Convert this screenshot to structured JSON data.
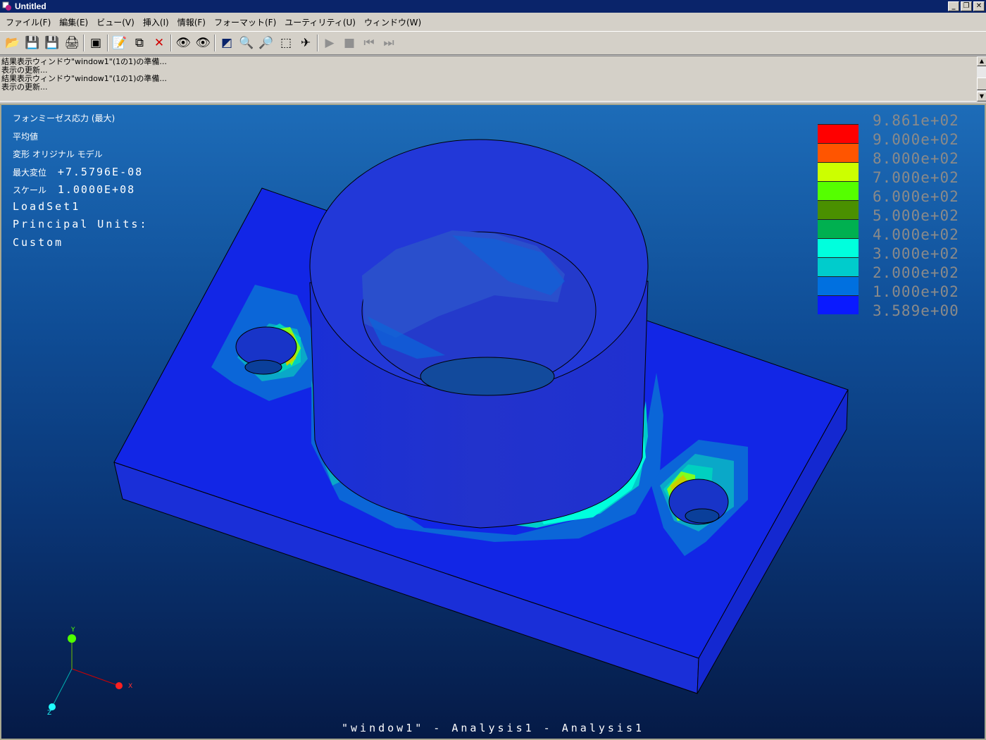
{
  "window": {
    "title": "Untitled",
    "minimize": "_",
    "restore": "❐",
    "close": "✕"
  },
  "menu": [
    "ファイル(F)",
    "編集(E)",
    "ビュー(V)",
    "挿入(I)",
    "情報(F)",
    "フォーマット(F)",
    "ユーティリティ(U)",
    "ウィンドウ(W)"
  ],
  "toolbar": {
    "buttons": [
      {
        "name": "open-icon",
        "glyph": "📂"
      },
      {
        "name": "save-icon",
        "glyph": "💾"
      },
      {
        "name": "save-as-icon",
        "glyph": "💾"
      },
      {
        "name": "print-icon",
        "glyph": "🖨"
      },
      {
        "sep": true
      },
      {
        "name": "info-window-icon",
        "glyph": "▣"
      },
      {
        "sep": true
      },
      {
        "name": "edit-icon",
        "glyph": "📝"
      },
      {
        "name": "copy-icon",
        "glyph": "⧉"
      },
      {
        "name": "delete-icon",
        "glyph": "✕",
        "color": "#d00000"
      },
      {
        "sep": true
      },
      {
        "name": "view-icon",
        "glyph": "👁"
      },
      {
        "name": "view-hide-icon",
        "glyph": "👁"
      },
      {
        "sep": true
      },
      {
        "name": "refit-icon",
        "glyph": "◩",
        "color": "#0a246a"
      },
      {
        "name": "zoom-in-icon",
        "glyph": "🔍"
      },
      {
        "name": "zoom-out-icon",
        "glyph": "🔎"
      },
      {
        "name": "zoom-window-icon",
        "glyph": "⬚"
      },
      {
        "name": "spin-icon",
        "glyph": "✈"
      },
      {
        "sep": true
      },
      {
        "name": "play-icon",
        "glyph": "▶",
        "disabled": true
      },
      {
        "name": "stop-icon",
        "glyph": "■",
        "disabled": true
      },
      {
        "name": "step-back-icon",
        "glyph": "⏮",
        "disabled": true
      },
      {
        "name": "step-forward-icon",
        "glyph": "⏭",
        "disabled": true
      }
    ]
  },
  "messages": [
    "結果表示ウィンドウ\"window1\"(1の1)の準備...",
    "表示の更新...",
    "結果表示ウィンドウ\"window1\"(1の1)の準備...",
    "表示の更新..."
  ],
  "viewport": {
    "info_jp": [
      "フォンミーゼス応力 (最大)",
      "平均値",
      "変形  オリジナル  モデル"
    ],
    "max_disp_label": "最大変位",
    "max_disp_value": "+7.5796E-08",
    "scale_label": "スケール",
    "scale_value": "1.0000E+08",
    "loadset": "LoadSet1",
    "units_line1": "Principal Units:",
    "units_line2": "Custom",
    "footer": "\"window1\" - Analysis1 - Analysis1",
    "triad": {
      "x": "X",
      "y": "Y",
      "z": "Z"
    }
  },
  "legend": {
    "labels": [
      "9.861e+02",
      "9.000e+02",
      "8.000e+02",
      "7.000e+02",
      "6.000e+02",
      "5.000e+02",
      "4.000e+02",
      "3.000e+02",
      "2.000e+02",
      "1.000e+02",
      "3.589e+00"
    ],
    "colors": [
      "#ff0000",
      "#ff5500",
      "#ccff00",
      "#55ff00",
      "#4a9000",
      "#00b050",
      "#00ffdd",
      "#00cccc",
      "#0070e0",
      "#0a1aff"
    ]
  }
}
